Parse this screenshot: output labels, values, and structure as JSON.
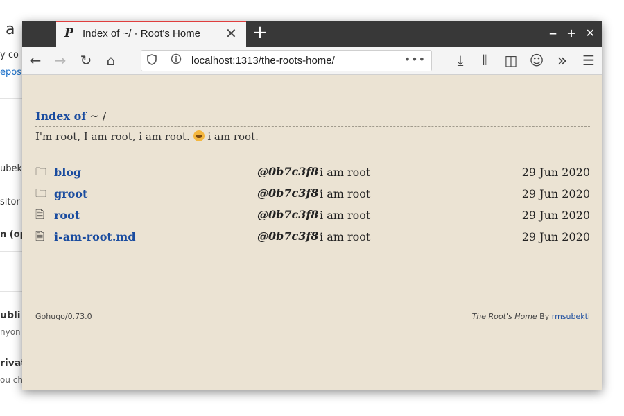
{
  "background_page": {
    "fragments": [
      "a",
      "y co",
      "eposi",
      "ubek",
      "sitor",
      "n (op",
      "ubli",
      "nyon",
      "rivat",
      "ou ch"
    ]
  },
  "browser": {
    "tab": {
      "favicon": "Ᵽ",
      "title": "Index of ~/ - Root's Home",
      "close": "✕"
    },
    "new_tab": "+",
    "window_controls": {
      "minimize": "‒",
      "maximize": "+",
      "close": "✕"
    },
    "toolbar": {
      "back_icon": "←",
      "forward_icon": "→",
      "reload_icon": "↻",
      "home_icon": "⌂",
      "url": "localhost:1313/the-roots-home/",
      "page_actions": "•••",
      "download_icon": "⤓",
      "library_icon": "⫴",
      "sidebar_icon": "◫",
      "account_icon": "☺",
      "overflow_icon": "»",
      "menu_icon": "☰"
    }
  },
  "page": {
    "heading_link": "Index of",
    "heading_path": " ~ /",
    "tagline_before": "I'm root, I am root, i am root.",
    "tagline_after": " i am root.",
    "entries": [
      {
        "type": "folder",
        "icon": "🗀",
        "name": "blog",
        "commit": "@0b7c3f8",
        "message": "i am root",
        "date": "29 Jun 2020"
      },
      {
        "type": "folder",
        "icon": "🗀",
        "name": "groot",
        "commit": "@0b7c3f8",
        "message": "i am root",
        "date": "29 Jun 2020"
      },
      {
        "type": "file",
        "icon": "🗎",
        "name": "root",
        "commit": "@0b7c3f8",
        "message": "i am root",
        "date": "29 Jun 2020"
      },
      {
        "type": "file",
        "icon": "🗎",
        "name": "i-am-root.md",
        "commit": "@0b7c3f8",
        "message": "i am root",
        "date": "29 Jun 2020"
      }
    ],
    "footer": {
      "generator": "Gohugo/0.73.0",
      "site_name": "The Root's Home",
      "by": " By ",
      "author": "rmsubekti"
    }
  }
}
